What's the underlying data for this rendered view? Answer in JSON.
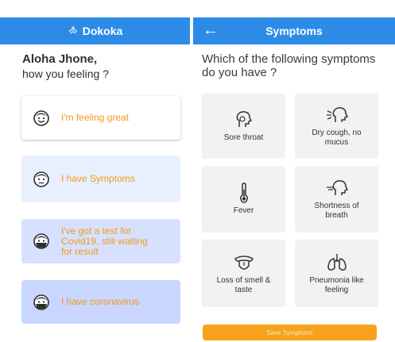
{
  "left_screen": {
    "app_title": "Dokoka",
    "greeting_name": "Aloha Jhone,",
    "greeting_question": "how you feeling ?",
    "options": [
      {
        "label": "I'm feeling great",
        "icon": "happy-face-icon"
      },
      {
        "label": "I have Symptoms",
        "icon": "neutral-face-icon"
      },
      {
        "label": "I've got a test for Covid19, still waiting for result",
        "icon": "masked-face-icon"
      },
      {
        "label": "I have coronavirus",
        "icon": "masked-face-icon"
      }
    ]
  },
  "right_screen": {
    "title": "Symptoms",
    "question": "Which of the following symptoms do you have ?",
    "symptoms": [
      {
        "label": "Sore throat",
        "icon": "sore-throat-icon"
      },
      {
        "label": "Dry cough, no mucus",
        "icon": "dry-cough-icon"
      },
      {
        "label": "Fever",
        "icon": "thermometer-icon"
      },
      {
        "label": "Shortness of breath",
        "icon": "breath-icon"
      },
      {
        "label": "Loss of smell & taste",
        "icon": "tongue-icon"
      },
      {
        "label": "Pneumonia like feeling",
        "icon": "lungs-icon"
      }
    ],
    "save_label": "Save Symptoms"
  },
  "colors": {
    "header_blue": "#2d8be8",
    "accent_orange": "#f29a18",
    "button_orange": "#f7a21b",
    "tile_gray": "#f2f2f2"
  }
}
